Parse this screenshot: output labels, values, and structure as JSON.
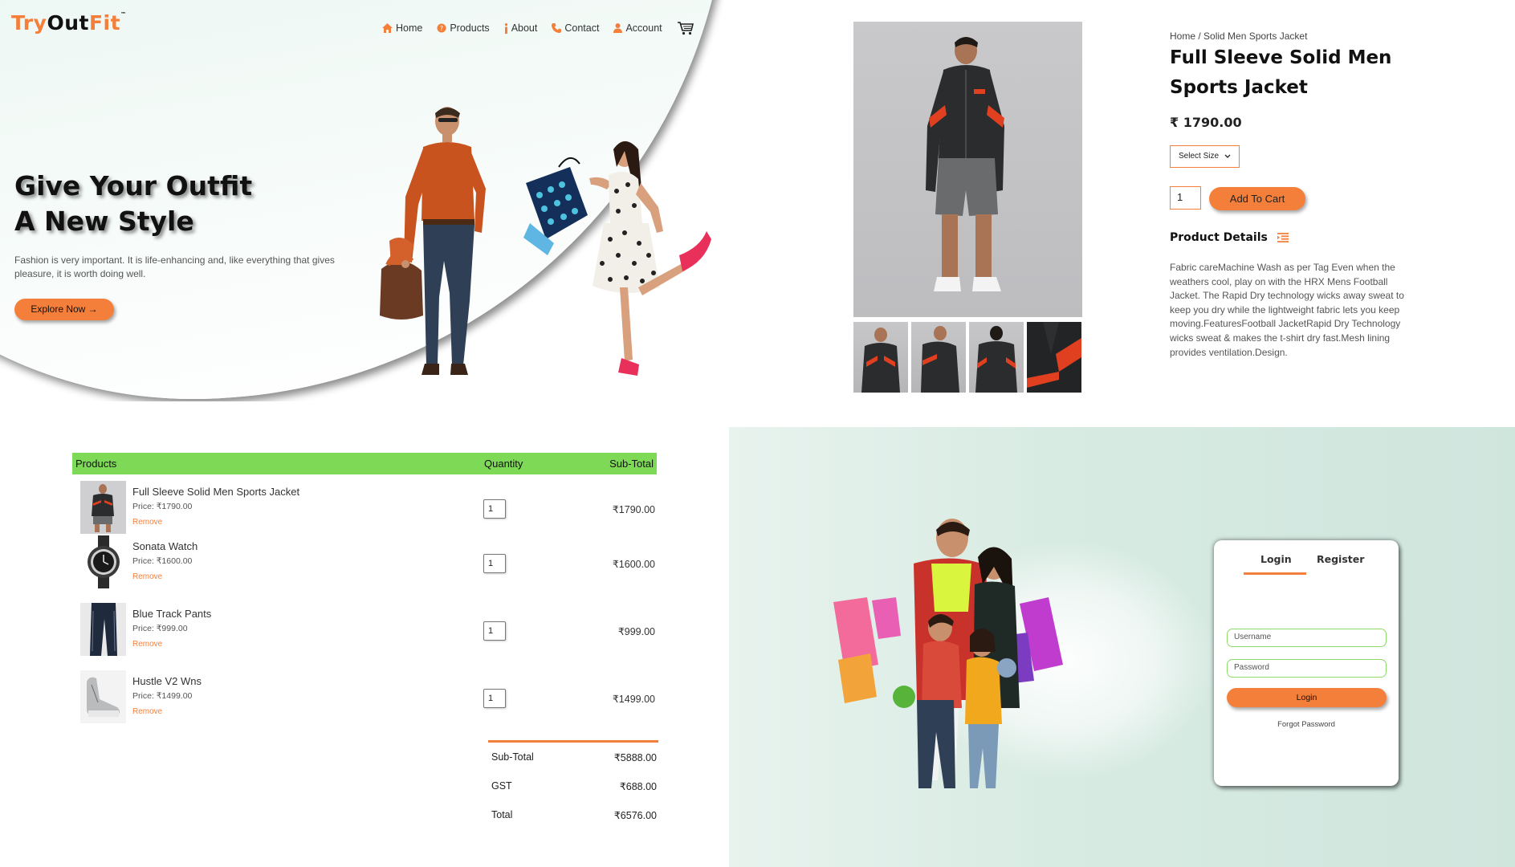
{
  "hero": {
    "logo": {
      "part1": "Try",
      "part2": "Out",
      "part3": "Fit",
      "tm": "™"
    },
    "nav": [
      {
        "label": "Home",
        "icon": "home-icon"
      },
      {
        "label": "Products",
        "icon": "products-icon"
      },
      {
        "label": "About",
        "icon": "info-icon"
      },
      {
        "label": "Contact",
        "icon": "phone-icon"
      },
      {
        "label": "Account",
        "icon": "user-icon"
      }
    ],
    "title_line1": "Give Your Outfit",
    "title_line2": "A New Style",
    "description": "Fashion is very important. It is life-enhancing and, like everything that gives pleasure, it is worth doing well.",
    "cta": "Explore Now →"
  },
  "product": {
    "breadcrumb": "Home / Solid Men Sports Jacket",
    "title": "Full Sleeve Solid Men Sports Jacket",
    "price": "₹ 1790.00",
    "size_select": "Select Size",
    "quantity": "1",
    "add_to_cart": "Add To Cart",
    "details_heading": "Product Details",
    "details_text": "Fabric careMachine Wash as per Tag Even when the weathers cool, play on with the HRX Mens Football Jacket. The Rapid Dry technology wicks away sweat to keep you dry while the lightweight fabric lets you keep moving.FeaturesFootball JacketRapid Dry Technology wicks sweat & makes the t-shirt dry fast.Mesh lining provides ventilation.Design."
  },
  "cart": {
    "headers": {
      "products": "Products",
      "quantity": "Quantity",
      "subtotal": "Sub-Total"
    },
    "items": [
      {
        "name": "Full Sleeve Solid Men Sports Jacket",
        "price": "Price: ₹1790.00",
        "remove": "Remove",
        "qty": "1",
        "subtotal": "₹1790.00"
      },
      {
        "name": "Sonata Watch",
        "price": "Price: ₹1600.00",
        "remove": "Remove",
        "qty": "1",
        "subtotal": "₹1600.00"
      },
      {
        "name": "Blue Track Pants",
        "price": "Price: ₹999.00",
        "remove": "Remove",
        "qty": "1",
        "subtotal": "₹999.00"
      },
      {
        "name": "Hustle V2 Wns",
        "price": "Price: ₹1499.00",
        "remove": "Remove",
        "qty": "1",
        "subtotal": "₹1499.00"
      }
    ],
    "totals": [
      {
        "label": "Sub-Total",
        "value": "₹5888.00"
      },
      {
        "label": "GST",
        "value": "₹688.00"
      },
      {
        "label": "Total",
        "value": "₹6576.00"
      }
    ]
  },
  "login": {
    "tab_login": "Login",
    "tab_register": "Register",
    "username_placeholder": "Username",
    "password_placeholder": "Password",
    "button": "Login",
    "forgot": "Forgot Password"
  },
  "colors": {
    "accent": "#f47f3a",
    "green": "#7ed957",
    "mint": "#d9efe6"
  }
}
